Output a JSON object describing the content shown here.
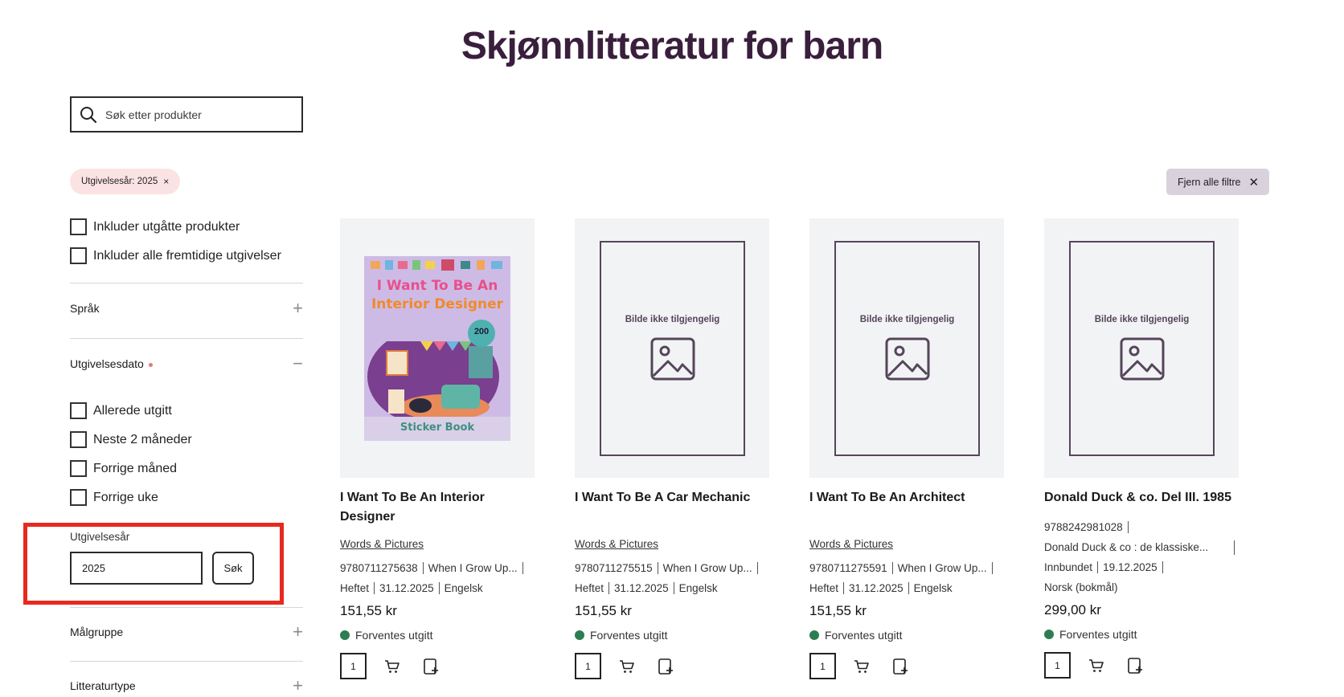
{
  "page": {
    "title": "Skjønnlitteratur for barn"
  },
  "search": {
    "placeholder": "Søk etter produkter"
  },
  "active_filter": {
    "label": "Utgivelsesår: 2025",
    "remove": "×"
  },
  "clear_filters": {
    "label": "Fjern alle filtre",
    "remove": "✕"
  },
  "options": [
    {
      "label": "Inkluder utgåtte produkter",
      "checked": false
    },
    {
      "label": "Inkluder alle fremtidige utgivelser",
      "checked": false
    }
  ],
  "facets": {
    "language": {
      "label": "Språk",
      "toggle": "+"
    },
    "release_date": {
      "label": "Utgivelsesdato",
      "toggle": "−"
    },
    "audience": {
      "label": "Målgruppe",
      "toggle": "+"
    },
    "literature_type": {
      "label": "Litteraturtype",
      "toggle": "+"
    }
  },
  "date_options": [
    {
      "label": "Allerede utgitt",
      "checked": false
    },
    {
      "label": "Neste 2 måneder",
      "checked": false
    },
    {
      "label": "Forrige måned",
      "checked": false
    },
    {
      "label": "Forrige uke",
      "checked": false
    }
  ],
  "year_filter": {
    "label": "Utgivelsesår",
    "value": "2025",
    "button": "Søk"
  },
  "placeholder_text": "Bilde ikke tilgjengelig",
  "cover_art": {
    "line1": "I Want To Be An",
    "line2": "Interior Designer",
    "badge": "200",
    "footer": "Sticker Book"
  },
  "products": [
    {
      "title": "I Want To Be An Interior Designer",
      "publisher": "Words & Pictures",
      "meta_row1": [
        "9780711275638",
        "When I Grow Up..."
      ],
      "meta_row2": [
        "Heftet",
        "31.12.2025",
        "Engelsk"
      ],
      "price": "151,55 kr",
      "status": "Forventes utgitt",
      "qty": "1",
      "has_image": true
    },
    {
      "title": "I Want To Be A Car Mechanic",
      "publisher": "Words & Pictures",
      "meta_row1": [
        "9780711275515",
        "When I Grow Up..."
      ],
      "meta_row2": [
        "Heftet",
        "31.12.2025",
        "Engelsk"
      ],
      "price": "151,55 kr",
      "status": "Forventes utgitt",
      "qty": "1",
      "has_image": false
    },
    {
      "title": "I Want To Be An Architect",
      "publisher": "Words & Pictures",
      "meta_row1": [
        "9780711275591",
        "When I Grow Up..."
      ],
      "meta_row2": [
        "Heftet",
        "31.12.2025",
        "Engelsk"
      ],
      "price": "151,55 kr",
      "status": "Forventes utgitt",
      "qty": "1",
      "has_image": false
    },
    {
      "title": "Donald Duck & co. Del III. 1985",
      "publisher": "",
      "meta_row1": [
        "9788242981028"
      ],
      "meta_row1b": [
        "Donald Duck & co : de klassiske..."
      ],
      "meta_row2": [
        "Innbundet",
        "19.12.2025"
      ],
      "meta_row3": [
        "Norsk (bokmål)"
      ],
      "price": "299,00 kr",
      "status": "Forventes utgitt",
      "qty": "1",
      "has_image": false
    }
  ],
  "colors": {
    "title": "#3a1f3d",
    "status_green": "#2e7d52",
    "highlight": "#e8291f",
    "chip_bg": "#fbe3e3",
    "clear_bg": "#d9d1db"
  },
  "icons": [
    "search-icon",
    "close-icon",
    "plus-icon",
    "minus-icon",
    "image-placeholder-icon",
    "cart-icon",
    "add-to-list-icon"
  ]
}
